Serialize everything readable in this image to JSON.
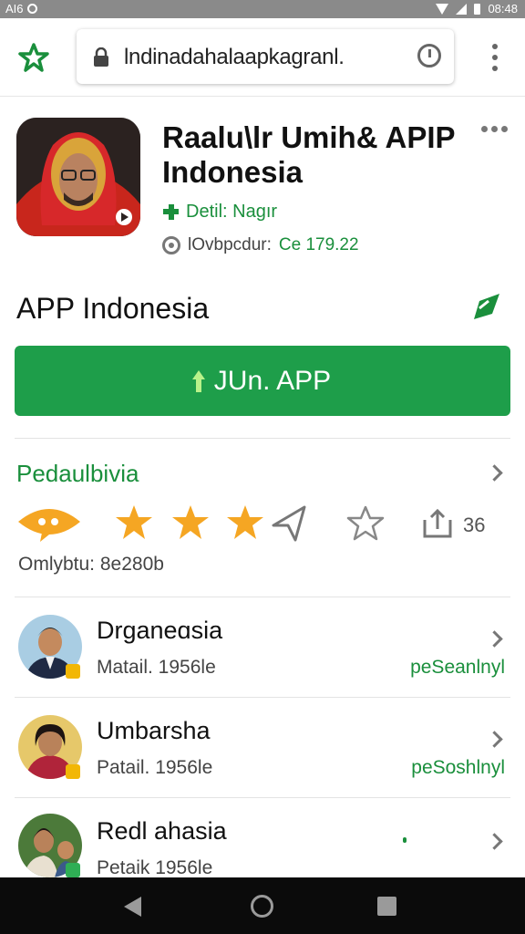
{
  "status_bar": {
    "left_text": "AI6",
    "time": "08:48"
  },
  "browser": {
    "url": "lndinadahalaapkagranl."
  },
  "app": {
    "title": "Raalu\\lr Umih& APIP Indonesia",
    "developer": "Detil: Nagır",
    "meta_label": "lOvbpcdur:",
    "meta_value": "Ce 179.22"
  },
  "section": {
    "title": "APP Indonesia"
  },
  "install_button": {
    "label": "JUn. APP"
  },
  "ratings": {
    "title": "Pedaulbivia",
    "count": "36",
    "subtitle": "Omlybtu: 8e280b",
    "stars_filled": 3,
    "stars_total": 5
  },
  "reviewers": [
    {
      "name": "Drganeɑsia",
      "sub": "Matail. 1956le",
      "action": "peSeanlnyl"
    },
    {
      "name": "Umbarsha",
      "sub": "Patail. 1956le",
      "action": "peSoshlnyl"
    },
    {
      "name": "Redl ahasia",
      "sub": "Petaik 1956le",
      "action": ""
    }
  ],
  "colors": {
    "accent_green": "#1e9e4a",
    "star_orange": "#f5a623",
    "text_green": "#1a8f3c"
  }
}
